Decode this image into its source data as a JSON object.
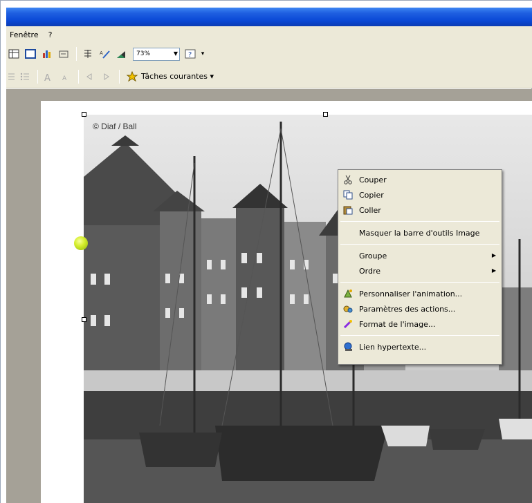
{
  "menubar": {
    "items": [
      "Fenêtre",
      "?"
    ]
  },
  "toolbar1": {
    "zoom_value": "73%"
  },
  "toolbar2": {
    "taches_label": "Tâches courantes ▾"
  },
  "photo": {
    "credit": "© Diaf / Ball"
  },
  "context_menu": {
    "items": [
      {
        "label": "Couper",
        "icon": "scissors-icon"
      },
      {
        "label": "Copier",
        "icon": "copy-icon"
      },
      {
        "label": "Coller",
        "icon": "paste-icon"
      },
      {
        "label": "Masquer la barre d'outils Image"
      },
      {
        "label": "Groupe",
        "submenu": true
      },
      {
        "label": "Ordre",
        "submenu": true
      },
      {
        "label": "Personnaliser l'animation...",
        "icon": "animation-icon"
      },
      {
        "label": "Paramètres des actions...",
        "icon": "action-settings-icon"
      },
      {
        "label": "Format de l'image...",
        "icon": "format-image-icon"
      },
      {
        "label": "Lien hypertexte...",
        "icon": "hyperlink-icon"
      }
    ]
  },
  "colors": {
    "titlebar": "#0a48d6",
    "chrome": "#ece9d8",
    "workspace": "#a5a197"
  }
}
